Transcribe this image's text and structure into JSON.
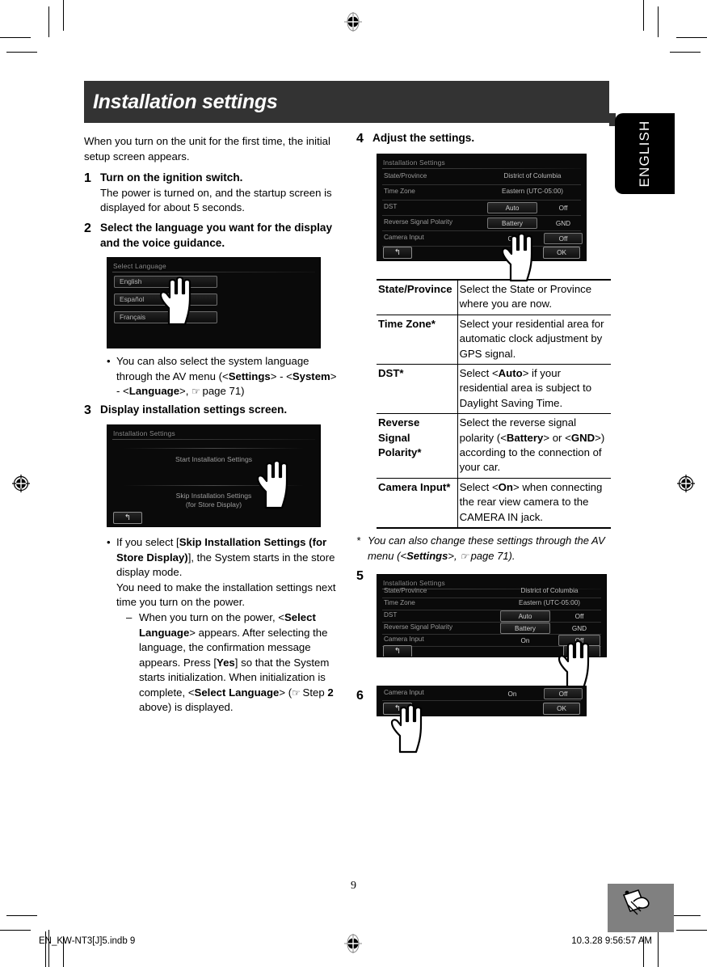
{
  "header": {
    "title": "Installation settings"
  },
  "side_tab": {
    "label": "ENGLISH"
  },
  "left": {
    "intro": "When you turn on the unit for the first time, the initial setup screen appears.",
    "steps": [
      {
        "num": "1",
        "head": "Turn on the ignition switch.",
        "text": "The power is turned on, and the startup screen is displayed for about 5 seconds."
      },
      {
        "num": "2",
        "head": "Select the language you want for the display and the voice guidance."
      },
      {
        "num": "3",
        "head": "Display installation settings screen."
      }
    ],
    "bullet_language": {
      "part1": "You can also select the system language through the AV menu (<",
      "b1": "Settings",
      "part2": "> - <",
      "b2": "System",
      "part3": "> - <",
      "b3": "Language",
      "part4": ">, ",
      "pointer": "page 71)"
    },
    "bullet_skip": {
      "p1": "If you select [",
      "b1": "Skip Installation Settings (for Store Display)",
      "p2": "], the System starts in the store display mode.",
      "p3": "You need to make the installation settings next time you turn on the power.",
      "sub": {
        "s1": "When you turn on the power, <",
        "sb1": "Select Language",
        "s2": "> appears. After selecting the language, the confirmation message appears. Press [",
        "sb2": "Yes",
        "s3": "] so that the System starts initialization. When initialization is complete, <",
        "sb3": "Select Language",
        "s4": "> (",
        "s5": " Step ",
        "sb4": "2",
        "s6": " above) is displayed."
      }
    }
  },
  "right": {
    "steps": [
      {
        "num": "4",
        "head": "Adjust the settings."
      },
      {
        "num": "5",
        "head": ""
      },
      {
        "num": "6",
        "head": ""
      }
    ],
    "table": {
      "rows": [
        {
          "key": "State/Province",
          "value_plain": "Select the State or Province where you are now."
        },
        {
          "key": "Time Zone*",
          "value_plain": "Select your residential area for automatic clock adjustment by GPS signal."
        },
        {
          "key": "DST*",
          "v1": "Select <",
          "vb1": "Auto",
          "v2": "> if your residential area is subject to Daylight Saving Time."
        },
        {
          "key": "Reverse Signal Polarity*",
          "v1": "Select the reverse signal polarity (<",
          "vb1": "Battery",
          "v2": "> or <",
          "vb2": "GND",
          "v3": ">) according to the connection of your car."
        },
        {
          "key": "Camera Input*",
          "v1": "Select <",
          "vb1": "On",
          "v2": "> when connecting the rear view camera to the CAMERA IN jack."
        }
      ]
    },
    "footnote": {
      "star": "*",
      "p1": "You can also change these settings through the AV menu (<",
      "b1": "Settings",
      "p2": ">, ",
      "p3": " page 71)."
    }
  },
  "shots": {
    "select_language": {
      "header": "Select Language",
      "items": [
        "English",
        "Español",
        "Français"
      ]
    },
    "installation_menu": {
      "header": "Installation Settings",
      "start": "Start Installation Settings",
      "skip": "Skip Installation Settings",
      "skip_sub": "(for Store Display)"
    },
    "settings_screen": {
      "header": "Installation Settings",
      "rows": [
        {
          "label": "State/Province",
          "value": "District of Columbia"
        },
        {
          "label": "Time Zone",
          "value": "Eastern (UTC-05:00)"
        },
        {
          "label": "DST",
          "opt1": "Auto",
          "opt2": "Off"
        },
        {
          "label": "Reverse Signal Polarity",
          "opt1": "Battery",
          "opt2": "GND"
        },
        {
          "label": "Camera Input",
          "opt1": "On",
          "opt2": "Off"
        }
      ],
      "ok": "OK"
    },
    "camera_input_bar": {
      "label": "Camera Input",
      "opt1": "On",
      "opt2": "Off",
      "ok": "OK"
    }
  },
  "footer": {
    "page_number": "9",
    "file_name": "EN_KW-NT3[J]5.indb   9",
    "timestamp": "10.3.28   9:56:57 AM"
  }
}
